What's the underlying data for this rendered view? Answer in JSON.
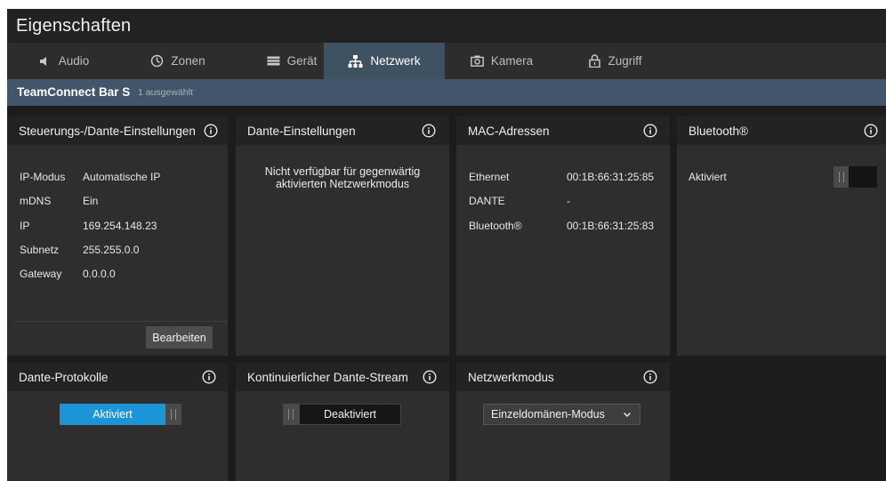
{
  "window": {
    "title": "Eigenschaften"
  },
  "tabs": [
    {
      "label": "Audio",
      "icon": "speaker-icon",
      "active": false
    },
    {
      "label": "Zonen",
      "icon": "zones-icon",
      "active": false
    },
    {
      "label": "Gerät",
      "icon": "device-icon",
      "active": false
    },
    {
      "label": "Netzwerk",
      "icon": "network-icon",
      "active": true
    },
    {
      "label": "Kamera",
      "icon": "camera-icon",
      "active": false
    },
    {
      "label": "Zugriff",
      "icon": "lock-icon",
      "active": false
    }
  ],
  "device": {
    "name": "TeamConnect Bar S",
    "selected_text": "1 ausgewählt"
  },
  "panels": {
    "control": {
      "title": "Steuerungs-/Dante-Einstellungen",
      "rows": [
        {
          "label": "IP-Modus",
          "value": "Automatische IP"
        },
        {
          "label": "mDNS",
          "value": "Ein"
        },
        {
          "label": "IP",
          "value": "169.254.148.23"
        },
        {
          "label": "Subnetz",
          "value": "255.255.0.0"
        },
        {
          "label": "Gateway",
          "value": "0.0.0.0"
        }
      ],
      "edit_label": "Bearbeiten"
    },
    "dante": {
      "title": "Dante-Einstellungen",
      "message_line1": "Nicht verfügbar für gegenwärtig",
      "message_line2": "aktivierten Netzwerkmodus"
    },
    "mac": {
      "title": "MAC-Adressen",
      "rows": [
        {
          "label": "Ethernet",
          "value": "00:1B:66:31:25:85"
        },
        {
          "label": "DANTE",
          "value": "-"
        },
        {
          "label": "Bluetooth®",
          "value": "00:1B:66:31:25:83"
        }
      ]
    },
    "bluetooth": {
      "title": "Bluetooth®",
      "label": "Aktiviert",
      "enabled": false
    },
    "protocols": {
      "title": "Dante-Protokolle",
      "toggle_label": "Aktiviert",
      "enabled": true
    },
    "stream": {
      "title": "Kontinuierlicher Dante-Stream",
      "toggle_label": "Deaktiviert",
      "enabled": false
    },
    "netmode": {
      "title": "Netzwerkmodus",
      "selected": "Einzeldomänen-Modus"
    }
  },
  "colors": {
    "accent": "#1b95d8",
    "active_tab": "#3f5262",
    "device_bar": "#42556a",
    "panel_bg": "#2e2e2e",
    "panel_header": "#232323"
  }
}
